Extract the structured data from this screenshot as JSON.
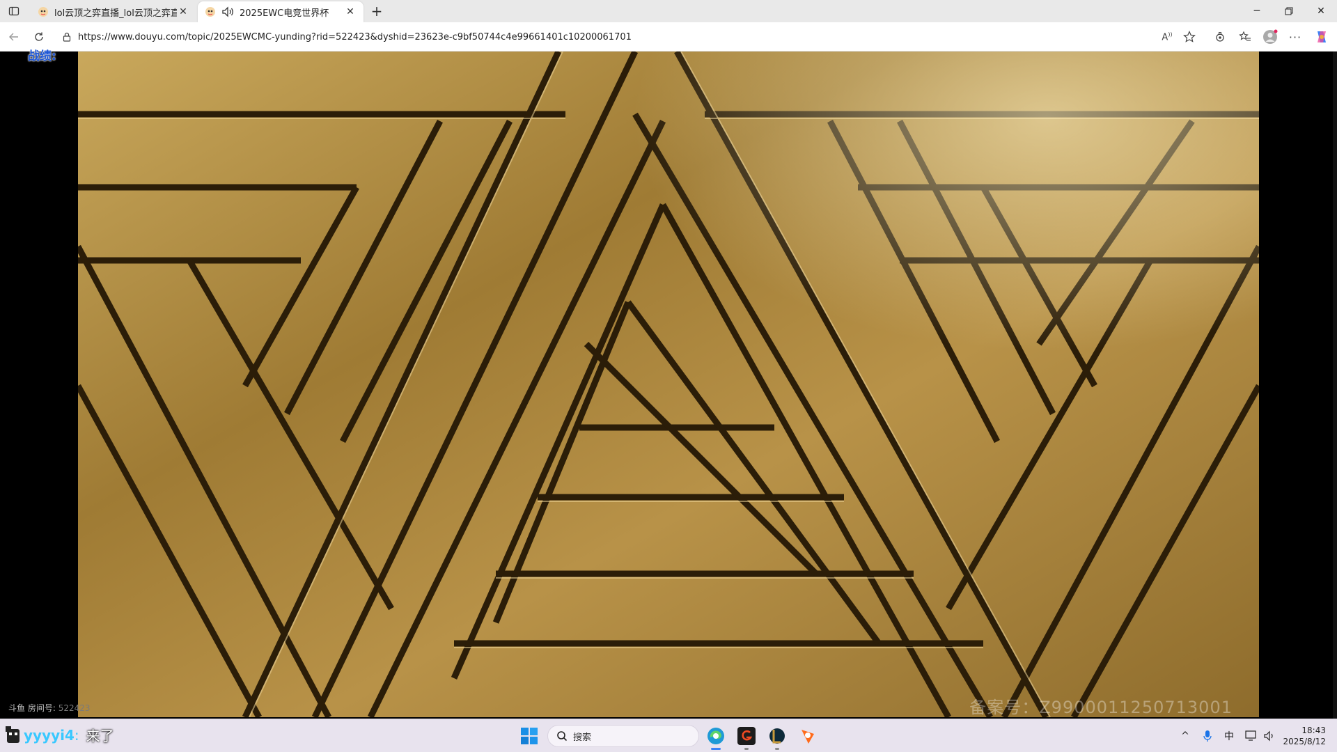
{
  "browser": {
    "tabs": [
      {
        "title": "lol云顶之弈直播_lol云顶之弈直播",
        "active": false
      },
      {
        "title": "2025EWC电竞世界杯",
        "active": true
      }
    ],
    "address": {
      "url": "https://www.douyu.com/topic/2025EWCMC-yunding?rid=522423&dyshid=23623e-c9bf50744c4e99661401c10200061701"
    },
    "window_controls": [
      "minimize",
      "restore",
      "close"
    ]
  },
  "player": {
    "corner_label": "战绩:",
    "room_label": "斗鱼 房间号:",
    "room_number": "522423",
    "icp_text": "备案号：Z990001125071300​1"
  },
  "danmu": {
    "user": "yyyyi4",
    "separator": ":",
    "message": "来了"
  },
  "taskbar": {
    "search_placeholder": "搜索",
    "ime": "中",
    "time": "18:43",
    "date": "2025/8/12"
  },
  "colors": {
    "gold": "#b08a3a",
    "gold_light": "#e3c98a",
    "gold_dark": "#3a2a10",
    "danmu_user": "#39c8ff",
    "label_blue": "#1e57d6"
  }
}
